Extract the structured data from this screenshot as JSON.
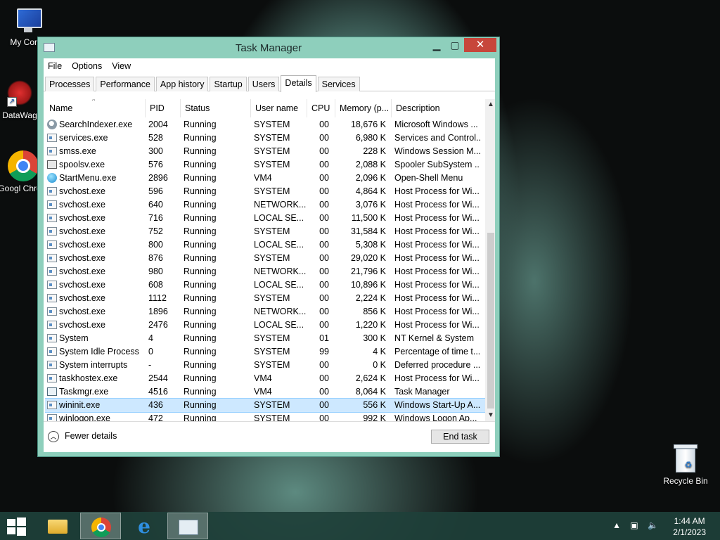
{
  "desktop": {
    "icons": [
      {
        "label": "My Comp"
      },
      {
        "label": "DataWag"
      },
      {
        "label": "Googl Chrom"
      },
      {
        "label": "Recycle Bin"
      }
    ]
  },
  "window": {
    "title": "Task Manager",
    "controls": {
      "minimize": "▁",
      "maximize": "▢",
      "close": "✕"
    }
  },
  "menu": [
    "File",
    "Options",
    "View"
  ],
  "tabs": [
    "Processes",
    "Performance",
    "App history",
    "Startup",
    "Users",
    "Details",
    "Services"
  ],
  "active_tab": "Details",
  "columns": [
    "Name",
    "PID",
    "Status",
    "User name",
    "CPU",
    "Memory (p...",
    "Description"
  ],
  "sort_indicator": "^",
  "rows": [
    {
      "icon": "search-indexer-icon",
      "name": "SearchIndexer.exe",
      "pid": "2004",
      "status": "Running",
      "user": "SYSTEM",
      "cpu": "00",
      "mem": "18,676 K",
      "desc": "Microsoft Windows ..."
    },
    {
      "icon": "service-icon",
      "name": "services.exe",
      "pid": "528",
      "status": "Running",
      "user": "SYSTEM",
      "cpu": "00",
      "mem": "6,980 K",
      "desc": "Services and Control..."
    },
    {
      "icon": "service-icon",
      "name": "smss.exe",
      "pid": "300",
      "status": "Running",
      "user": "SYSTEM",
      "cpu": "00",
      "mem": "228 K",
      "desc": "Windows Session M..."
    },
    {
      "icon": "printer-icon",
      "name": "spoolsv.exe",
      "pid": "576",
      "status": "Running",
      "user": "SYSTEM",
      "cpu": "00",
      "mem": "2,088 K",
      "desc": "Spooler SubSystem ..."
    },
    {
      "icon": "start-menu-icon",
      "name": "StartMenu.exe",
      "pid": "2896",
      "status": "Running",
      "user": "VM4",
      "cpu": "00",
      "mem": "2,096 K",
      "desc": "Open-Shell Menu"
    },
    {
      "icon": "service-icon",
      "name": "svchost.exe",
      "pid": "596",
      "status": "Running",
      "user": "SYSTEM",
      "cpu": "00",
      "mem": "4,864 K",
      "desc": "Host Process for Wi..."
    },
    {
      "icon": "service-icon",
      "name": "svchost.exe",
      "pid": "640",
      "status": "Running",
      "user": "NETWORK...",
      "cpu": "00",
      "mem": "3,076 K",
      "desc": "Host Process for Wi..."
    },
    {
      "icon": "service-icon",
      "name": "svchost.exe",
      "pid": "716",
      "status": "Running",
      "user": "LOCAL SE...",
      "cpu": "00",
      "mem": "11,500 K",
      "desc": "Host Process for Wi..."
    },
    {
      "icon": "service-icon",
      "name": "svchost.exe",
      "pid": "752",
      "status": "Running",
      "user": "SYSTEM",
      "cpu": "00",
      "mem": "31,584 K",
      "desc": "Host Process for Wi..."
    },
    {
      "icon": "service-icon",
      "name": "svchost.exe",
      "pid": "800",
      "status": "Running",
      "user": "LOCAL SE...",
      "cpu": "00",
      "mem": "5,308 K",
      "desc": "Host Process for Wi..."
    },
    {
      "icon": "service-icon",
      "name": "svchost.exe",
      "pid": "876",
      "status": "Running",
      "user": "SYSTEM",
      "cpu": "00",
      "mem": "29,020 K",
      "desc": "Host Process for Wi..."
    },
    {
      "icon": "service-icon",
      "name": "svchost.exe",
      "pid": "980",
      "status": "Running",
      "user": "NETWORK...",
      "cpu": "00",
      "mem": "21,796 K",
      "desc": "Host Process for Wi..."
    },
    {
      "icon": "service-icon",
      "name": "svchost.exe",
      "pid": "608",
      "status": "Running",
      "user": "LOCAL SE...",
      "cpu": "00",
      "mem": "10,896 K",
      "desc": "Host Process for Wi..."
    },
    {
      "icon": "service-icon",
      "name": "svchost.exe",
      "pid": "1112",
      "status": "Running",
      "user": "SYSTEM",
      "cpu": "00",
      "mem": "2,224 K",
      "desc": "Host Process for Wi..."
    },
    {
      "icon": "service-icon",
      "name": "svchost.exe",
      "pid": "1896",
      "status": "Running",
      "user": "NETWORK...",
      "cpu": "00",
      "mem": "856 K",
      "desc": "Host Process for Wi..."
    },
    {
      "icon": "service-icon",
      "name": "svchost.exe",
      "pid": "2476",
      "status": "Running",
      "user": "LOCAL SE...",
      "cpu": "00",
      "mem": "1,220 K",
      "desc": "Host Process for Wi..."
    },
    {
      "icon": "service-icon",
      "name": "System",
      "pid": "4",
      "status": "Running",
      "user": "SYSTEM",
      "cpu": "01",
      "mem": "300 K",
      "desc": "NT Kernel & System"
    },
    {
      "icon": "service-icon",
      "name": "System Idle Process",
      "pid": "0",
      "status": "Running",
      "user": "SYSTEM",
      "cpu": "99",
      "mem": "4 K",
      "desc": "Percentage of time t..."
    },
    {
      "icon": "service-icon",
      "name": "System interrupts",
      "pid": "-",
      "status": "Running",
      "user": "SYSTEM",
      "cpu": "00",
      "mem": "0 K",
      "desc": "Deferred procedure ..."
    },
    {
      "icon": "service-icon",
      "name": "taskhostex.exe",
      "pid": "2544",
      "status": "Running",
      "user": "VM4",
      "cpu": "00",
      "mem": "2,624 K",
      "desc": "Host Process for Wi..."
    },
    {
      "icon": "task-manager-icon",
      "name": "Taskmgr.exe",
      "pid": "4516",
      "status": "Running",
      "user": "VM4",
      "cpu": "00",
      "mem": "8,064 K",
      "desc": "Task Manager"
    },
    {
      "icon": "service-icon",
      "name": "wininit.exe",
      "pid": "436",
      "status": "Running",
      "user": "SYSTEM",
      "cpu": "00",
      "mem": "556 K",
      "desc": "Windows Start-Up A...",
      "selected": true
    },
    {
      "icon": "service-icon",
      "name": "winlogon.exe",
      "pid": "472",
      "status": "Running",
      "user": "SYSTEM",
      "cpu": "00",
      "mem": "992 K",
      "desc": "Windows Logon Ap..."
    }
  ],
  "footer": {
    "fewer_details": "Fewer details",
    "end_task": "End task"
  },
  "taskbar": {
    "items": [
      "start-icon",
      "file-explorer-icon",
      "chrome-icon",
      "internet-explorer-icon",
      "task-manager-icon"
    ],
    "clock_time": "1:44 AM",
    "clock_date": "2/1/2023"
  },
  "colors": {
    "window_frame": "#8ecfbc",
    "close_button": "#c7463b",
    "selection": "#cde8ff"
  }
}
